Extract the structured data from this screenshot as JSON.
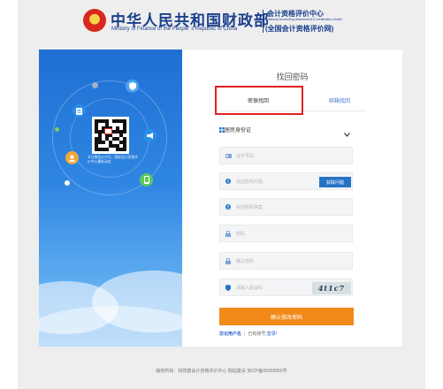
{
  "header": {
    "ministry_cn": "中华人民共和国财政部",
    "ministry_en": "Ministry of Finance of the People' s Republic of China",
    "center_cn": "会计资格评价中心",
    "center_en": "National Accounting Assessment & Certification Center",
    "center_sub": "(全国会计资格评价网)"
  },
  "left_panel": {
    "qr_caption": "关注微信公众号，获取会计资格评价中心最新动态"
  },
  "form": {
    "title": "找回密码",
    "tabs": [
      {
        "label": "密保找回",
        "active": true
      },
      {
        "label": "邮箱找回",
        "active": false
      }
    ],
    "id_type": {
      "selected": "居民身份证"
    },
    "fields": {
      "id_number": "证件号码",
      "security_question": "找回密码问题",
      "security_answer": "找回密码答案",
      "password": "密码",
      "confirm_password": "确认密码",
      "captcha": "请输入验证码"
    },
    "get_question_label": "获取问题",
    "captcha_text": "4t1c7",
    "confirm_label": "确认修改密码",
    "forgot_username": "忘记用户名",
    "separator": "|",
    "have_account": "已有账号,",
    "login": "登录!"
  },
  "footer": {
    "text": "版权所有：财政部会计资格评价中心  网站建设  京ICP备05002860号"
  },
  "colors": {
    "brand_blue": "#1a3f8c",
    "panel_blue": "#1f6fd3",
    "action_blue": "#2573c7",
    "confirm_orange": "#f18a1a",
    "highlight_red": "#e02121"
  }
}
